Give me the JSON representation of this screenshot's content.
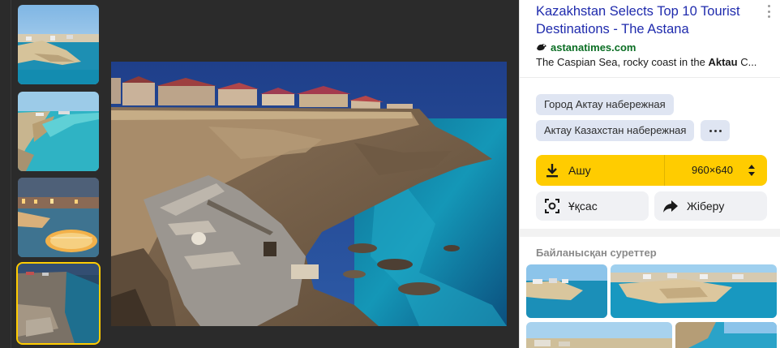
{
  "result": {
    "title": "Kazakhstan Selects Top 10 Tourist Destinations - The Astana",
    "source": "astanatimes.com",
    "snippet_before": "The Caspian Sea, rocky coast in the ",
    "snippet_bold": "Aktau",
    "snippet_after": " C..."
  },
  "tags": [
    "Город Актау набережная",
    "Актау Казахстан набережная"
  ],
  "actions": {
    "download_label": "Ашу",
    "image_size": "960×640",
    "search_label": "Ұқсас",
    "share_label": "Жіберу"
  },
  "related": {
    "title": "Байланысқан суреттер"
  },
  "icons": {
    "download": "download-icon",
    "lens": "lens-icon",
    "share": "share-arrow-icon",
    "more": "more-dots-icon",
    "menu": "kebab-menu-icon"
  },
  "colors": {
    "accent": "#ffcc00",
    "title_link": "#1f2bad",
    "source": "#0b6e24",
    "tag_bg": "#dfe5f2"
  }
}
